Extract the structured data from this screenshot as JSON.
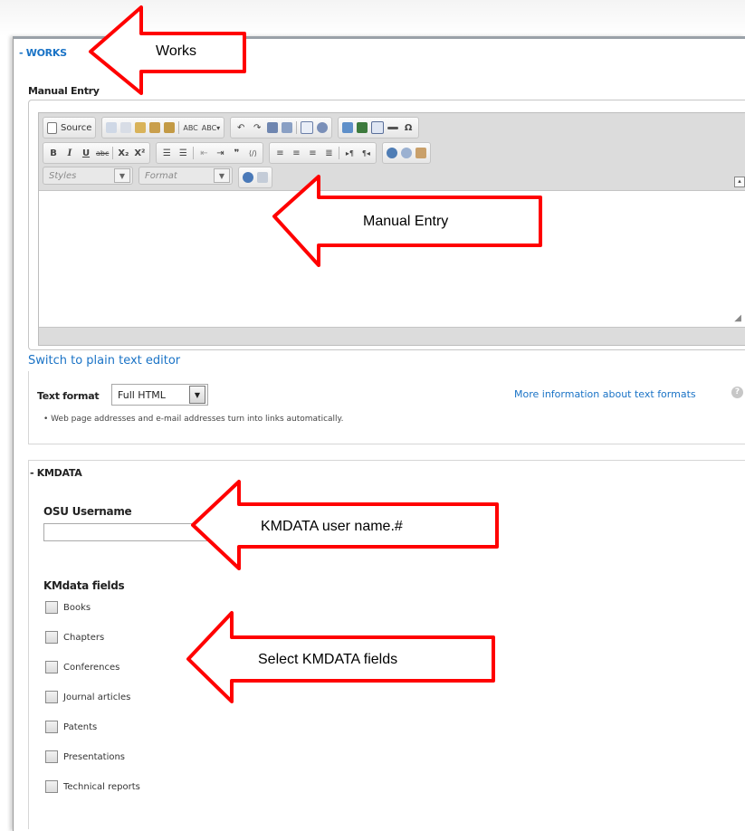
{
  "works": {
    "legend": "- WORKS"
  },
  "manual_entry": {
    "label": "Manual Entry"
  },
  "toolbar": {
    "source_label": "Source",
    "bold": "B",
    "italic": "I",
    "underline": "U",
    "strike": "abc",
    "subscript": "X₂",
    "superscript": "X²",
    "special_char": "Ω",
    "styles_placeholder": "Styles",
    "format_placeholder": "Format"
  },
  "switch_editor": {
    "label": "Switch to plain text editor"
  },
  "text_format": {
    "label": "Text format",
    "selected": "Full HTML",
    "more_info": "More information about text formats",
    "tip": "• Web page addresses and e-mail addresses turn into links automatically."
  },
  "kmdata": {
    "legend": "- KMDATA",
    "username_label": "OSU Username",
    "username_value": "",
    "fields_label": "KMdata fields",
    "fields": [
      {
        "label": "Books",
        "checked": false
      },
      {
        "label": "Chapters",
        "checked": false
      },
      {
        "label": "Conferences",
        "checked": false
      },
      {
        "label": "Journal articles",
        "checked": false
      },
      {
        "label": "Patents",
        "checked": false
      },
      {
        "label": "Presentations",
        "checked": false
      },
      {
        "label": "Technical reports",
        "checked": false
      }
    ]
  },
  "annotations": {
    "works": "Works",
    "manual_entry": "Manual Entry",
    "username": "KMDATA user name.#",
    "fields": "Select KMDATA fields",
    "arrow_color": "#ff0000"
  }
}
